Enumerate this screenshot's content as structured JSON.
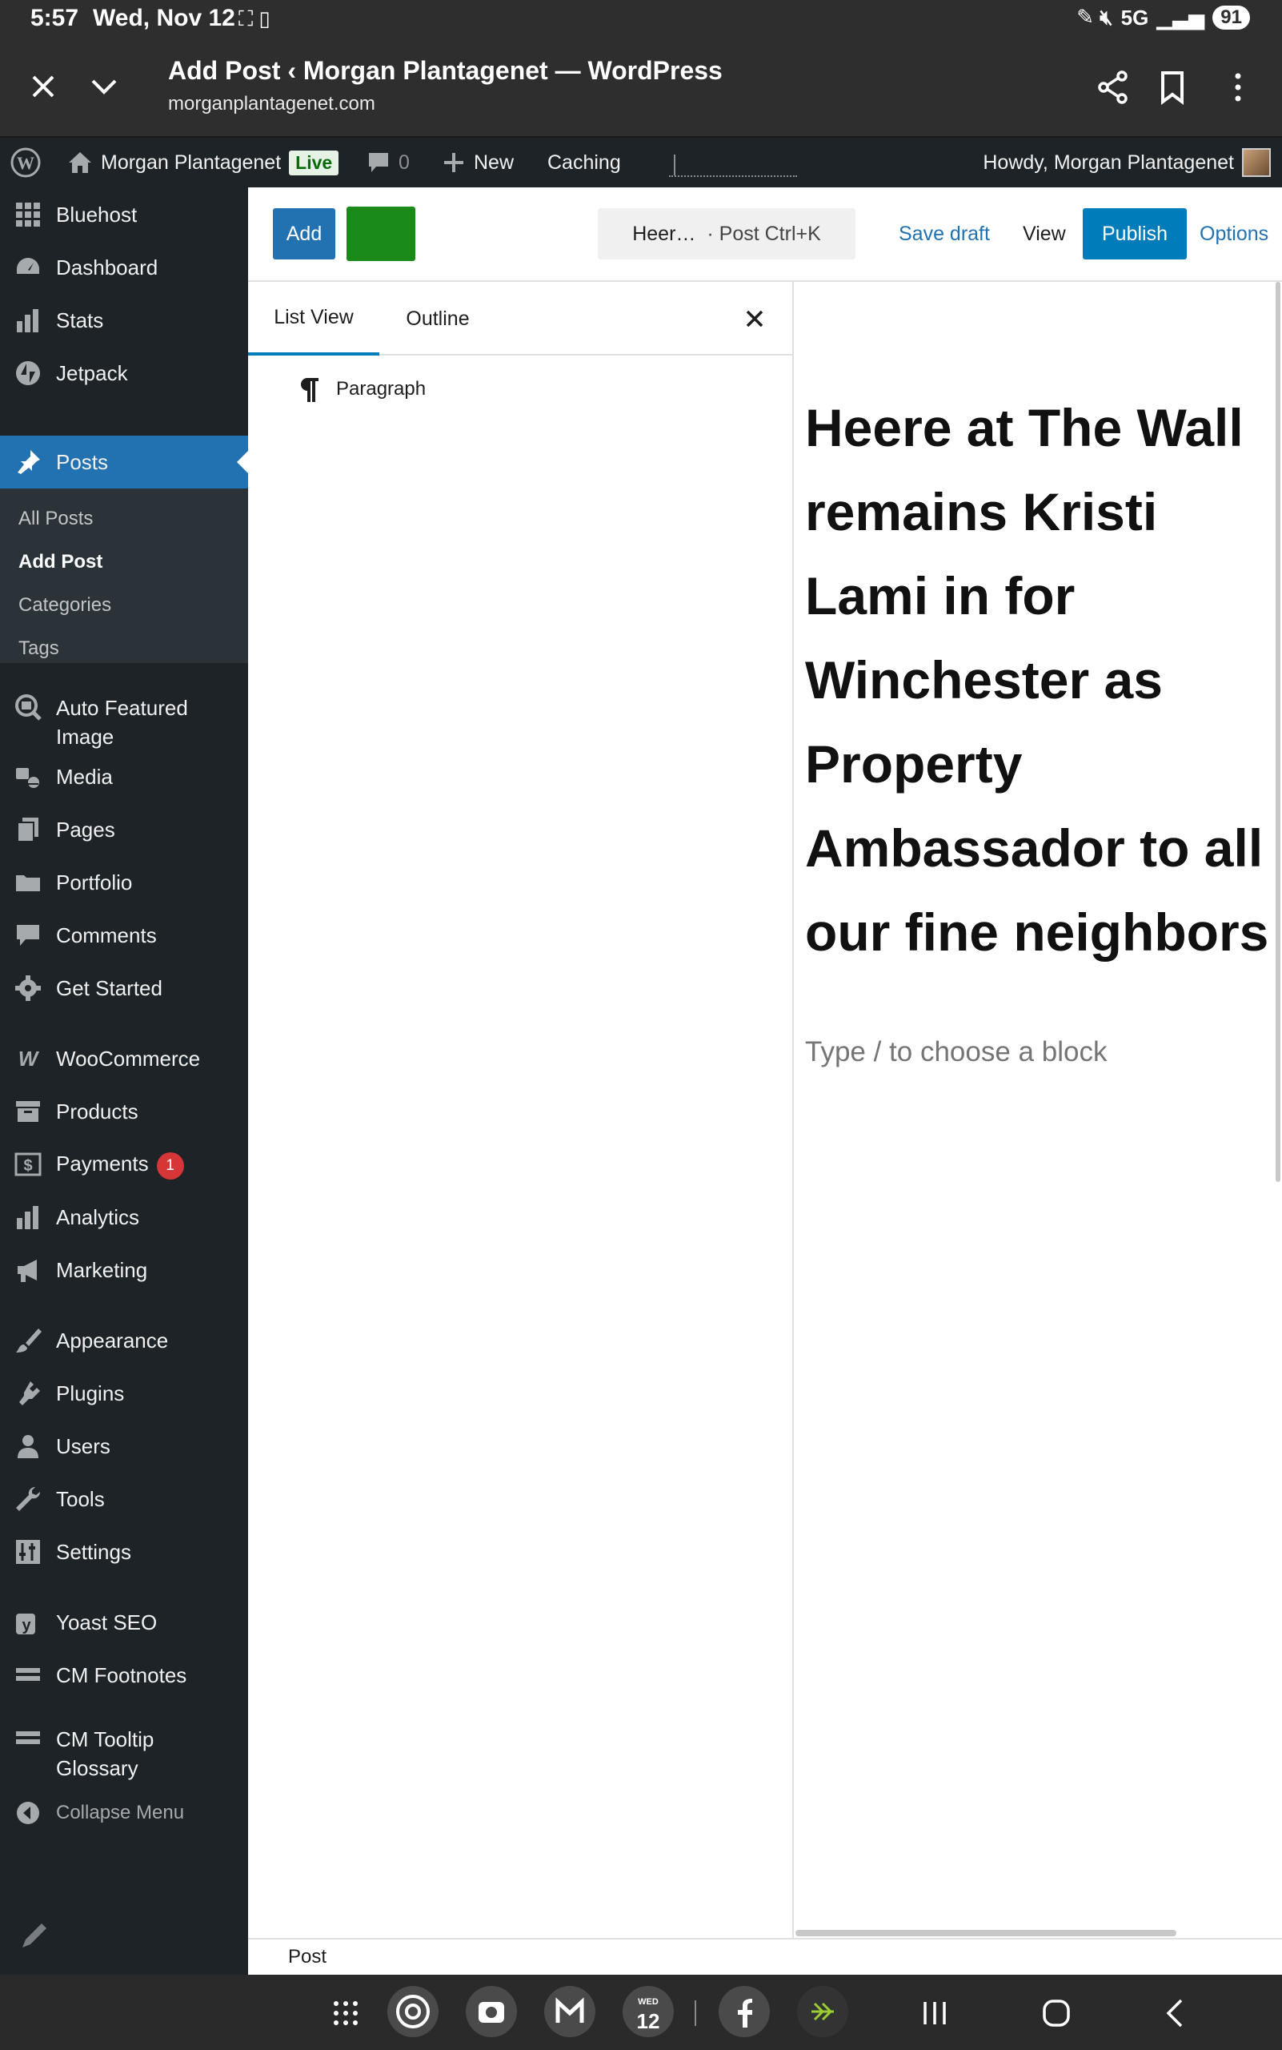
{
  "status_bar": {
    "time": "5:57",
    "date": "Wed, Nov 12",
    "network": "5G",
    "battery": "91"
  },
  "browser": {
    "title": "Add Post ‹ Morgan Plantagenet — WordPress",
    "url": "morganplantagenet.com"
  },
  "admin_bar": {
    "site_name": "Morgan Plantagenet",
    "live_badge": "Live",
    "comment_count": "0",
    "new_label": "New",
    "caching_label": "Caching",
    "howdy": "Howdy, Morgan Plantagenet"
  },
  "sidebar": {
    "items": [
      {
        "label": "Bluehost",
        "icon": "grid-icon"
      },
      {
        "label": "Dashboard",
        "icon": "dashboard-icon"
      },
      {
        "label": "Stats",
        "icon": "stats-icon"
      },
      {
        "label": "Jetpack",
        "icon": "jetpack-icon"
      },
      {
        "label": "Posts",
        "icon": "pin-icon"
      },
      {
        "label": "Auto Featured Image",
        "icon": "image-search-icon"
      },
      {
        "label": "Media",
        "icon": "media-icon"
      },
      {
        "label": "Pages",
        "icon": "pages-icon"
      },
      {
        "label": "Portfolio",
        "icon": "folder-icon"
      },
      {
        "label": "Comments",
        "icon": "comment-icon"
      },
      {
        "label": "Get Started",
        "icon": "gear-icon"
      },
      {
        "label": "WooCommerce",
        "icon": "woo-icon"
      },
      {
        "label": "Products",
        "icon": "archive-icon"
      },
      {
        "label": "Payments",
        "icon": "dollar-icon",
        "badge": "1"
      },
      {
        "label": "Analytics",
        "icon": "bar-chart-icon"
      },
      {
        "label": "Marketing",
        "icon": "megaphone-icon"
      },
      {
        "label": "Appearance",
        "icon": "brush-icon"
      },
      {
        "label": "Plugins",
        "icon": "plug-icon"
      },
      {
        "label": "Users",
        "icon": "user-icon"
      },
      {
        "label": "Tools",
        "icon": "wrench-icon"
      },
      {
        "label": "Settings",
        "icon": "sliders-icon"
      },
      {
        "label": "Yoast SEO",
        "icon": "yoast-icon"
      },
      {
        "label": "CM Footnotes",
        "icon": "list-icon"
      },
      {
        "label": "CM Tooltip Glossary",
        "icon": "list-icon"
      },
      {
        "label": "Collapse Menu",
        "icon": "collapse-icon"
      }
    ],
    "posts_sub": [
      "All Posts",
      "Add Post",
      "Categories",
      "Tags"
    ]
  },
  "editor_header": {
    "add_label": "Add",
    "cmd_title": "Heer…",
    "cmd_hint": "· Post Ctrl+K",
    "save_draft": "Save draft",
    "view": "View",
    "publish": "Publish",
    "options": "Options"
  },
  "list_view": {
    "tabs": [
      "List View",
      "Outline"
    ],
    "blocks": [
      {
        "label": "Paragraph",
        "icon": "paragraph-icon"
      }
    ]
  },
  "canvas": {
    "title": "Heere at The Wall remains Kristi Lami in for Winchester as Property Ambassador to all our fine neighbors",
    "placeholder": "Type / to choose a block"
  },
  "footer": {
    "breadcrumb": "Post"
  },
  "taskbar": {
    "calendar_day": "12",
    "calendar_weekday": "WED"
  },
  "colors": {
    "wp_blue": "#2271b1",
    "admin_dark": "#1d2327",
    "publish_blue": "#007cba",
    "green_button": "#1a8a1a",
    "badge_red": "#d63638"
  }
}
